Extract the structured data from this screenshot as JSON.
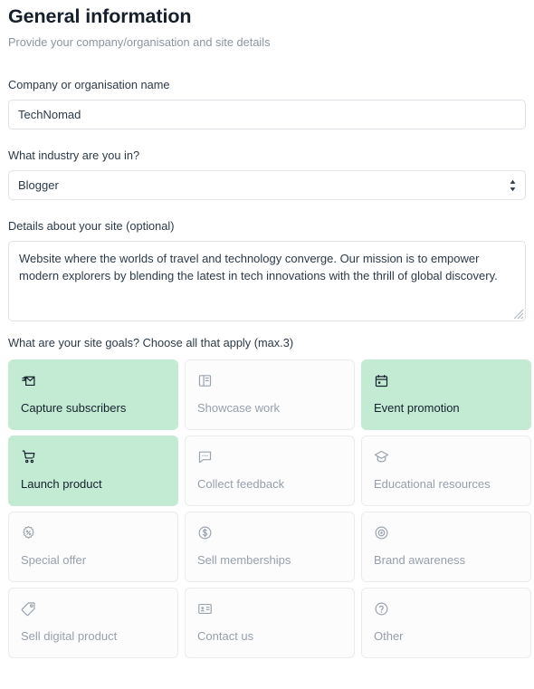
{
  "header": {
    "title": "General information",
    "subtitle": "Provide your company/organisation and site details"
  },
  "form": {
    "company": {
      "label": "Company or organisation name",
      "value": "TechNomad",
      "placeholder": ""
    },
    "industry": {
      "label": "What industry are you in?",
      "value": "Blogger",
      "options": [
        "Blogger"
      ]
    },
    "details": {
      "label": "Details about your site (optional)",
      "value": "Website where the worlds of travel and technology converge. Our mission is to empower modern explorers by blending the latest in tech innovations with the thrill of global discovery.",
      "placeholder": ""
    }
  },
  "goals": {
    "question": "What are your site goals? Choose all that apply (max.3)",
    "max": 3,
    "selected_color": "#c3ebd4",
    "items": [
      {
        "label": "Capture subscribers",
        "icon": "mail-incoming-icon",
        "selected": true
      },
      {
        "label": "Showcase work",
        "icon": "layout-panel-icon",
        "selected": false
      },
      {
        "label": "Event promotion",
        "icon": "calendar-icon",
        "selected": true
      },
      {
        "label": "Launch product",
        "icon": "shopping-cart-icon",
        "selected": true
      },
      {
        "label": "Collect feedback",
        "icon": "chat-bubble-icon",
        "selected": false
      },
      {
        "label": "Educational resources",
        "icon": "graduation-cap-icon",
        "selected": false
      },
      {
        "label": "Special offer",
        "icon": "percent-badge-icon",
        "selected": false
      },
      {
        "label": "Sell memberships",
        "icon": "dollar-circle-icon",
        "selected": false
      },
      {
        "label": "Brand awareness",
        "icon": "eye-target-icon",
        "selected": false
      },
      {
        "label": "Sell digital product",
        "icon": "tag-icon",
        "selected": false
      },
      {
        "label": "Contact us",
        "icon": "contact-card-icon",
        "selected": false
      },
      {
        "label": "Other",
        "icon": "question-mark-icon",
        "selected": false
      }
    ]
  }
}
